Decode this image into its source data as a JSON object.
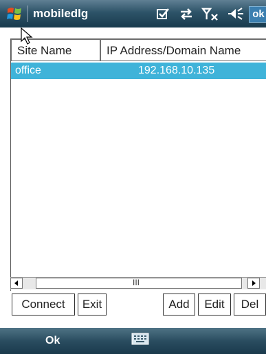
{
  "titlebar": {
    "app_title": "mobiledlg",
    "ok_label": "ok",
    "icons": [
      "windows-start-icon",
      "notification-check-icon",
      "connectivity-arrows-icon",
      "signal-off-icon",
      "speaker-icon"
    ]
  },
  "listview": {
    "columns": [
      "Site Name",
      "IP Address/Domain Name"
    ],
    "rows": [
      {
        "site": "office",
        "address": "192.168.10.135",
        "selected": true
      }
    ]
  },
  "scrollbar": {
    "thumb_glyph": "III"
  },
  "buttons": {
    "connect": "Connect",
    "exit": "Exit",
    "add": "Add",
    "edit": "Edit",
    "del": "Del"
  },
  "bottombar": {
    "left_softkey": "Ok",
    "input_icon": "keyboard-icon"
  },
  "colors": {
    "title_bar": "#2d5368",
    "selection": "#3fb3d9",
    "ok_button": "#3b7fb0"
  }
}
